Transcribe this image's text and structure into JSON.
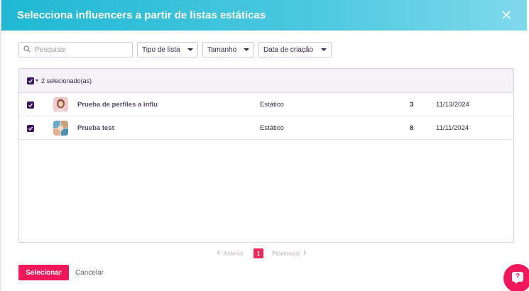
{
  "header": {
    "title": "Selecciona influencers a partir de listas estáticas",
    "close_icon": "close-icon"
  },
  "filters": {
    "search_placeholder": "Pesquisar",
    "search_value": "",
    "list_type_label": "Tipo de lista",
    "size_label": "Tamanho",
    "created_date_label": "Data de criação"
  },
  "table": {
    "selected_label": "2 selecionado(as)",
    "rows": [
      {
        "name": "Prueba de perfiles a influ",
        "type": "Estático",
        "count": "3",
        "date": "11/13/2024",
        "checked": true,
        "avatar": "profile-avatar-woman"
      },
      {
        "name": "Prueba test",
        "type": "Estático",
        "count": "8",
        "date": "11/11/2024",
        "checked": true,
        "avatar": "profile-avatar-group"
      }
    ]
  },
  "pagination": {
    "prev_label": "Anterior",
    "current_page": "1",
    "next_label": "Próximo(a)"
  },
  "footer": {
    "select_label": "Selecionar",
    "cancel_label": "Cancelar"
  },
  "help": {
    "label": "?"
  },
  "colors": {
    "header_gradient_start": "#1fb8d3",
    "header_gradient_end": "#7fd9eb",
    "accent": "#f0185a",
    "checkbox": "#3a1560",
    "text": "#3b2a4d"
  }
}
